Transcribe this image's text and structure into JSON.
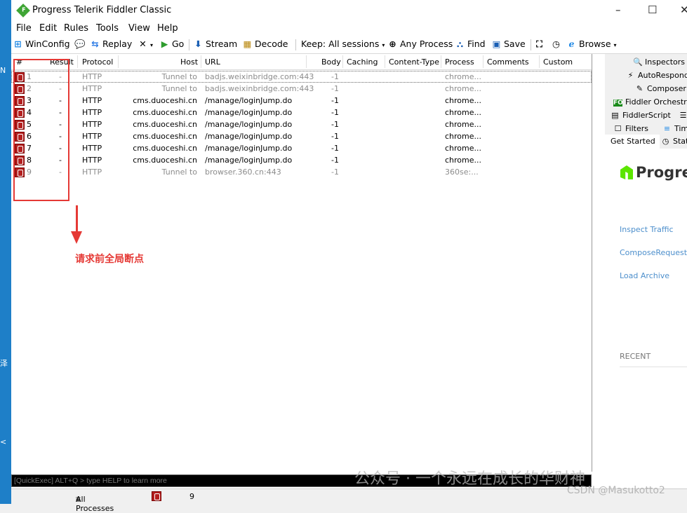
{
  "window": {
    "title": "Progress Telerik Fiddler Classic",
    "controls": [
      "–",
      "☐",
      "✕"
    ]
  },
  "menu": [
    "File",
    "Edit",
    "Rules",
    "Tools",
    "View",
    "Help"
  ],
  "toolbar": {
    "winconfig": "WinConfig",
    "replay": "Replay",
    "go": "Go",
    "stream": "Stream",
    "decode": "Decode",
    "keep": "Keep: All sessions",
    "any_process": "Any Process",
    "find": "Find",
    "save": "Save",
    "browse": "Browse"
  },
  "sessions": {
    "columns": [
      "#",
      "Result",
      "Protocol",
      "Host",
      "URL",
      "Body",
      "Caching",
      "Content-Type",
      "Process",
      "Comments",
      "Custom"
    ],
    "rows": [
      {
        "num": "1",
        "result": "-",
        "protocol": "HTTP",
        "host": "Tunnel to",
        "url": "badjs.weixinbridge.com:443",
        "body": "-1",
        "process": "chrome...",
        "tunnel": true
      },
      {
        "num": "2",
        "result": "-",
        "protocol": "HTTP",
        "host": "Tunnel to",
        "url": "badjs.weixinbridge.com:443",
        "body": "-1",
        "process": "chrome...",
        "tunnel": true
      },
      {
        "num": "3",
        "result": "-",
        "protocol": "HTTP",
        "host": "cms.duoceshi.cn",
        "url": "/manage/loginJump.do",
        "body": "-1",
        "process": "chrome...",
        "tunnel": false
      },
      {
        "num": "4",
        "result": "-",
        "protocol": "HTTP",
        "host": "cms.duoceshi.cn",
        "url": "/manage/loginJump.do",
        "body": "-1",
        "process": "chrome...",
        "tunnel": false
      },
      {
        "num": "5",
        "result": "-",
        "protocol": "HTTP",
        "host": "cms.duoceshi.cn",
        "url": "/manage/loginJump.do",
        "body": "-1",
        "process": "chrome...",
        "tunnel": false
      },
      {
        "num": "6",
        "result": "-",
        "protocol": "HTTP",
        "host": "cms.duoceshi.cn",
        "url": "/manage/loginJump.do",
        "body": "-1",
        "process": "chrome...",
        "tunnel": false
      },
      {
        "num": "7",
        "result": "-",
        "protocol": "HTTP",
        "host": "cms.duoceshi.cn",
        "url": "/manage/loginJump.do",
        "body": "-1",
        "process": "chrome...",
        "tunnel": false
      },
      {
        "num": "8",
        "result": "-",
        "protocol": "HTTP",
        "host": "cms.duoceshi.cn",
        "url": "/manage/loginJump.do",
        "body": "-1",
        "process": "chrome...",
        "tunnel": false
      },
      {
        "num": "9",
        "result": "-",
        "protocol": "HTTP",
        "host": "Tunnel to",
        "url": "browser.360.cn:443",
        "body": "-1",
        "process": "360se:...",
        "tunnel": true
      }
    ]
  },
  "annotation": {
    "text": "请求前全局断点",
    "color": "#e53935"
  },
  "quickexec": {
    "placeholder": "[QuickExec] ALT+Q > type HELP to learn more"
  },
  "statusbar": {
    "filter": "All Processes",
    "count": "9"
  },
  "right_panel": {
    "tabs": {
      "inspectors": "Inspectors",
      "autoresponder": "AutoResponder",
      "composer": "Composer",
      "orchestra": "Fiddler Orchestra Be",
      "fiddlerscript": "FiddlerScript",
      "log": "Lo",
      "filters": "Filters",
      "timeline": "Timelin",
      "get_started": "Get Started",
      "statistics": "Statist"
    },
    "brand": "Progress",
    "links": [
      "Inspect Traffic",
      "ComposeRequest",
      "Load Archive"
    ],
    "recent": "RECENT"
  },
  "watermark": {
    "wechat": "公众号 · 一个永远在成长的华财神",
    "csdn": "CSDN @Masukotto2"
  }
}
